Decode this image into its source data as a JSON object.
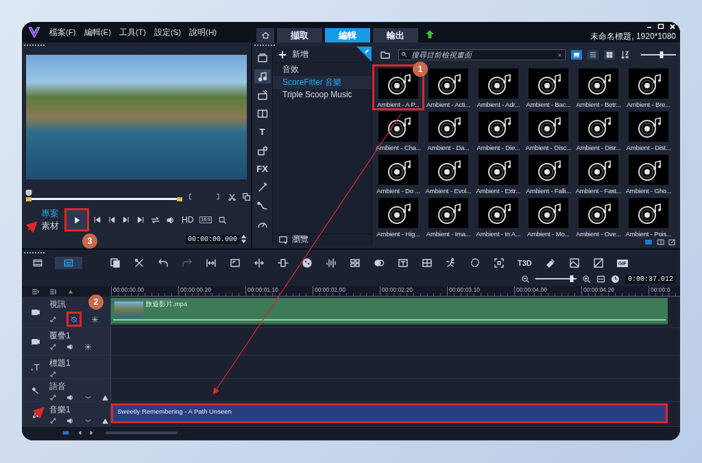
{
  "menu": [
    "檔案(F)",
    "編輯(E)",
    "工具(T)",
    "設定(S)",
    "說明(H)"
  ],
  "tabs": [
    {
      "label": "擷取",
      "selected": false
    },
    {
      "label": "編輯",
      "selected": true
    },
    {
      "label": "輸出",
      "selected": false
    }
  ],
  "project_title": "未命名標題, 1920*1080",
  "preview": {
    "scrubber": {
      "level": 0
    },
    "modes": [
      {
        "label": "專案",
        "selected": true
      },
      {
        "label": "素材",
        "selected": false
      }
    ],
    "play_marked": true,
    "hd_label": "HD",
    "aspect_label": "16:9",
    "timecode": "00:00:00.000"
  },
  "library": {
    "side_tabs": [
      {
        "kind": "media",
        "selected": false
      },
      {
        "kind": "audio",
        "selected": true
      },
      {
        "kind": "transition",
        "selected": false
      },
      {
        "kind": "ab",
        "selected": false
      },
      {
        "kind": "title",
        "label": "T",
        "selected": false
      },
      {
        "kind": "graphics",
        "selected": false
      },
      {
        "kind": "fx",
        "label": "FX",
        "selected": false
      },
      {
        "kind": "wand",
        "selected": false
      },
      {
        "kind": "path",
        "selected": false
      },
      {
        "kind": "gauge",
        "selected": false
      }
    ],
    "add_label": "新增",
    "folders": [
      {
        "label": "音效",
        "selected": false
      },
      {
        "label": "ScoreFitter 音樂",
        "selected": true
      },
      {
        "label": "Triple Scoop Music",
        "selected": false
      }
    ],
    "browse_label": "瀏覽",
    "search_placeholder": "搜尋目前檢視畫面",
    "zoom": {
      "level": 0.6
    },
    "items": [
      {
        "label": "Ambient - A P...",
        "marked": true
      },
      {
        "label": "Ambient - Acti...",
        "marked": false
      },
      {
        "label": "Ambient - Adr...",
        "marked": false
      },
      {
        "label": "Ambient - Bac...",
        "marked": false
      },
      {
        "label": "Ambient - Betr...",
        "marked": false
      },
      {
        "label": "Ambient - Bre...",
        "marked": false
      },
      {
        "label": "Ambient - Cha...",
        "marked": false
      },
      {
        "label": "Ambient - Da...",
        "marked": false
      },
      {
        "label": "Ambient - Die...",
        "marked": false
      },
      {
        "label": "Ambient - Disc...",
        "marked": false
      },
      {
        "label": "Ambient - Disr...",
        "marked": false
      },
      {
        "label": "Ambient - Dist...",
        "marked": false
      },
      {
        "label": "Ambient - Do ...",
        "marked": false
      },
      {
        "label": "Ambient - Evol...",
        "marked": false
      },
      {
        "label": "Ambient - Extr...",
        "marked": false
      },
      {
        "label": "Ambient - Falli...",
        "marked": false
      },
      {
        "label": "Ambient - Fast...",
        "marked": false
      },
      {
        "label": "Ambient - Gho...",
        "marked": false
      },
      {
        "label": "Ambient - Hig...",
        "marked": false
      },
      {
        "label": "Ambient - Ima...",
        "marked": false
      },
      {
        "label": "Ambient - In A...",
        "marked": false
      },
      {
        "label": "Ambient - Mo...",
        "marked": false
      },
      {
        "label": "Ambient - Ove...",
        "marked": false
      },
      {
        "label": "Ambient - Pois...",
        "marked": false
      }
    ]
  },
  "timeline": {
    "views": [
      {
        "kind": "storyboard",
        "selected": false
      },
      {
        "kind": "timeline",
        "selected": true
      }
    ],
    "tools": [
      {
        "kind": "copy",
        "disabled": false
      },
      {
        "kind": "tools",
        "disabled": false
      },
      {
        "kind": "undo",
        "disabled": false
      },
      {
        "kind": "redo",
        "disabled": true
      },
      {
        "kind": "fit",
        "disabled": false
      },
      {
        "kind": "frame",
        "disabled": false
      },
      {
        "kind": "split",
        "disabled": false
      },
      {
        "kind": "resize",
        "disabled": false
      },
      {
        "kind": "palette",
        "disabled": false
      },
      {
        "kind": "wave",
        "disabled": false
      },
      {
        "kind": "multicam",
        "disabled": false
      },
      {
        "kind": "blend",
        "disabled": false
      },
      {
        "kind": "subtitle",
        "disabled": false
      },
      {
        "kind": "grid",
        "disabled": false
      },
      {
        "kind": "motion",
        "disabled": false
      },
      {
        "kind": "mask",
        "disabled": false
      },
      {
        "kind": "focus",
        "disabled": false
      },
      {
        "kind": "title3d",
        "label": "T3D",
        "disabled": false
      },
      {
        "kind": "paint",
        "disabled": false
      },
      {
        "kind": "scene",
        "disabled": false
      },
      {
        "kind": "image",
        "disabled": false
      },
      {
        "kind": "gif",
        "label": "GIF",
        "disabled": false
      }
    ],
    "zoom": {
      "level": 0.88
    },
    "timecode": "0:00:37.012",
    "ruler": [
      "00:00:00.00",
      "00:00:00.20",
      "00:00:01.10",
      "00:00:02.00",
      "00:00:02.20",
      "00:00:03.10",
      "00:00:04.00",
      "00:00:04.20",
      "00:00:0"
    ],
    "ripple_marked": true,
    "tracks": [
      {
        "name": "視訊",
        "kind": "video",
        "clip": {
          "label": "旅遊影片.mp4",
          "kind": "video",
          "marked": false
        }
      },
      {
        "name": "覆疊1",
        "kind": "overlay"
      },
      {
        "name": "標題1",
        "kind": "title"
      },
      {
        "name": "語音",
        "kind": "voice"
      },
      {
        "name": "音樂1",
        "kind": "music",
        "clip": {
          "label": "Sweetly Remembering - A Path Unseen",
          "kind": "audio",
          "marked": true
        }
      }
    ]
  },
  "callouts": [
    {
      "label": "1",
      "kind": "library"
    },
    {
      "label": "2",
      "kind": "track"
    },
    {
      "label": "3",
      "kind": "play"
    }
  ]
}
